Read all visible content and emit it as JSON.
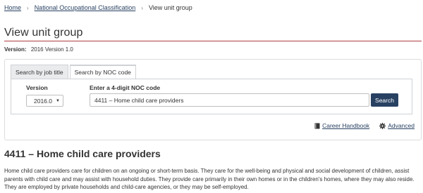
{
  "breadcrumb": {
    "home": "Home",
    "noc": "National Occupational Classification",
    "current": "View unit group",
    "separator": "›"
  },
  "page": {
    "title": "View unit group",
    "version_label": "Version:",
    "version_value": "2016 Version 1.0"
  },
  "tabs": [
    {
      "label": "Search by job title",
      "active": false
    },
    {
      "label": "Search by NOC code",
      "active": true
    }
  ],
  "form": {
    "version_label": "Version",
    "version_selected": "2016.0",
    "code_label": "Enter a 4-digit NOC code",
    "code_value": "4411 – Home child care providers",
    "search_button": "Search"
  },
  "links": {
    "career_handbook": "Career Handbook",
    "advanced": "Advanced"
  },
  "unit_group": {
    "heading": "4411 – Home child care providers",
    "description": "Home child care providers care for children on an ongoing or short-term basis. They care for the well-being and physical and social development of children, assist parents with child care and may assist with household duties. They provide care primarily in their own homes or in the children's homes, where they may also reside. They are employed by private households and child-care agencies, or they may be self-employed."
  },
  "colors": {
    "accent_rule": "#af3c43",
    "link": "#284162",
    "button": "#284162"
  }
}
